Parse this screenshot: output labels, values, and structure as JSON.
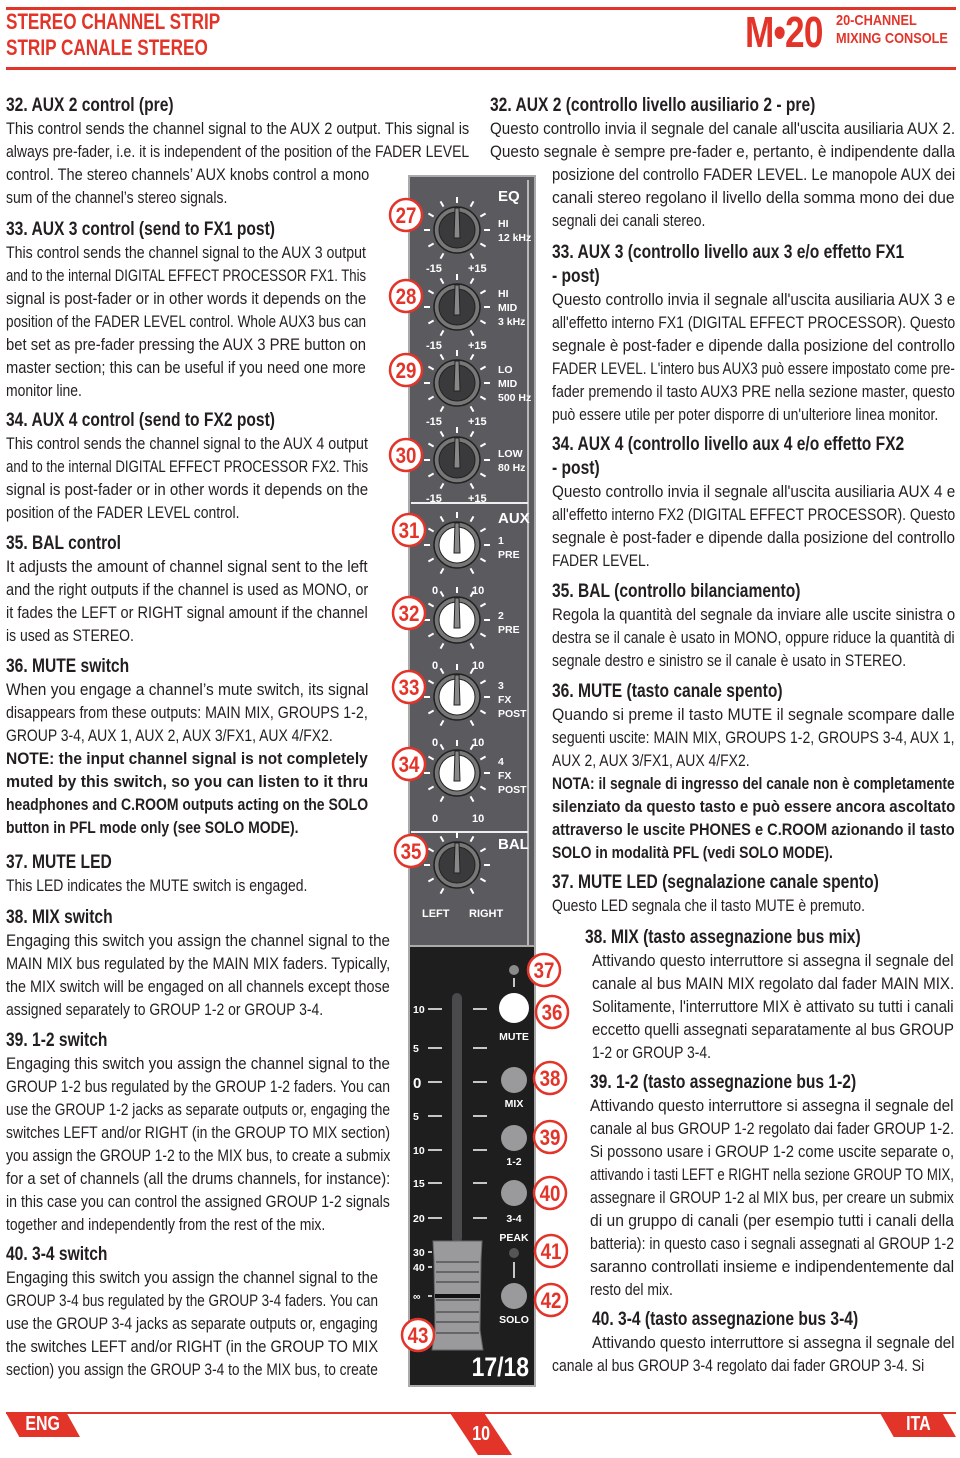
{
  "header": {
    "title_en": "STEREO CHANNEL STRIP",
    "title_it": "STRIP CANALE STEREO",
    "logo": "M•20",
    "logo_sub1": "20-CHANNEL",
    "logo_sub2": "MIXING CONSOLE"
  },
  "colors": {
    "accent": "#e3342a",
    "panel": "#5b5b5f",
    "panel_dark": "#1e1e1f"
  },
  "left": {
    "sections": [
      {
        "heading": [
          "32. AUX 2 control (pre)"
        ],
        "paragraphs": [
          {
            "bold": false,
            "lines": [
              "This control sends the channel signal to the AUX 2 output. This signal is",
              "always pre-fader, i.e. it is independent of the position of the FADER LEVEL",
              "control. The stereo channels’ AUX knobs control a mono",
              "sum of the channel’s stereo signals."
            ]
          }
        ]
      },
      {
        "heading": [
          "33. AUX 3 control (send to FX1 post)"
        ],
        "paragraphs": [
          {
            "bold": false,
            "lines": [
              "This control sends the channel signal to the AUX 3 output",
              "and to the internal DIGITAL EFFECT PROCESSOR FX1. This",
              "signal is post-fader or in other words it depends on the",
              "position of the FADER LEVEL control. Whole AUX3 bus can",
              "bet set as pre-fader pressing the AUX 3 PRE button on",
              "master section; this can be useful if you need one more",
              "monitor line."
            ]
          }
        ]
      },
      {
        "heading": [
          "34. AUX 4 control (send to FX2 post)"
        ],
        "paragraphs": [
          {
            "bold": false,
            "lines": [
              "This control sends the channel signal to the AUX 4 output",
              "and to the internal DIGITAL EFFECT PROCESSOR FX2. This",
              "signal is post-fader or in other words it depends on the",
              "position of the FADER LEVEL control."
            ]
          }
        ]
      },
      {
        "heading": [
          "35. BAL control"
        ],
        "paragraphs": [
          {
            "bold": false,
            "lines": [
              "It adjusts the amount of channel signal sent to the left",
              "and the right outputs if the channel is used as MONO, or",
              "it fades the LEFT or RIGHT signal amount if the channel",
              "is used as STEREO."
            ]
          }
        ]
      },
      {
        "heading": [
          "36. MUTE switch"
        ],
        "paragraphs": [
          {
            "bold": false,
            "lines": [
              "When you engage a channel’s mute switch, its signal",
              "disappears from these outputs: MAIN MIX, GROUPS 1-2,",
              "GROUP 3-4, AUX 1, AUX 2, AUX 3/FX1, AUX 4/FX2."
            ]
          },
          {
            "bold": true,
            "lines": [
              "NOTE: the input channel signal is not completely",
              "muted by this switch, so you can listen to it thru",
              "headphones and C.ROOM outputs acting on the SOLO",
              "button in PFL mode only (see SOLO MODE)."
            ]
          }
        ]
      },
      {
        "heading": [
          "37. MUTE LED"
        ],
        "paragraphs": [
          {
            "bold": false,
            "lines": [
              "This LED indicates the MUTE switch is engaged."
            ]
          }
        ]
      },
      {
        "heading": [
          "38. MIX switch"
        ],
        "paragraphs": [
          {
            "bold": false,
            "lines": [
              "Engaging this switch you assign the channel signal to the",
              "MAIN MIX bus regulated by the MAIN MIX faders. Typically,",
              "the MIX switch will be engaged on all channels except those",
              "assigned separately to GROUP 1-2 or GROUP 3-4."
            ]
          }
        ]
      },
      {
        "heading": [
          "39. 1-2 switch"
        ],
        "paragraphs": [
          {
            "bold": false,
            "lines": [
              "Engaging this switch you assign the channel signal to the",
              "GROUP 1-2 bus regulated by the GROUP 1-2 faders. You can",
              "use the GROUP 1-2 jacks as separate outputs or, engaging the",
              "switches LEFT and/or RIGHT (in the GROUP TO MIX section)",
              "you assign the GROUP 1-2 to the MIX bus, to create a submix",
              "for a set of channels (all the drums channels, for instance):",
              "in this case you can control the assigned GROUP 1-2 signals",
              "together and independently from the rest of the mix."
            ]
          }
        ]
      },
      {
        "heading": [
          "40. 3-4 switch"
        ],
        "paragraphs": [
          {
            "bold": false,
            "lines": [
              "Engaging this switch you assign the channel signal to the",
              "GROUP 3-4 bus regulated by the GROUP 3-4 faders. You can",
              "use the GROUP 3-4 jacks as separate outputs or, engaging",
              "the switches LEFT and/or RIGHT (in the GROUP TO MIX",
              "section) you assign the GROUP 3-4 to the MIX bus, to create"
            ]
          }
        ]
      }
    ]
  },
  "right": {
    "sections": [
      {
        "heading": [
          "32. AUX 2 (controllo livello ausiliario 2 - pre)"
        ],
        "paragraphs": [
          {
            "bold": false,
            "lines": [
              "Questo controllo invia il segnale del canale all'uscita ausiliaria AUX 2.",
              "Questo segnale è sempre pre-fader e, pertanto, è indipendente dalla",
              "posizione del controllo FADER LEVEL. Le manopole AUX dei",
              "canali stereo regolano il livello della somma mono dei due",
              "segnali dei canali stereo."
            ]
          }
        ]
      },
      {
        "heading": [
          "33. AUX 3 (controllo livello aux 3 e/o effetto FX1",
          "- post)"
        ],
        "paragraphs": [
          {
            "bold": false,
            "lines": [
              "Questo controllo invia il segnale all'uscita ausiliaria AUX 3 e",
              "all'effetto interno FX1 (DIGITAL EFFECT PROCESSOR). Questo",
              "segnale è post-fader e dipende dalla posizione del controllo",
              "FADER LEVEL. L'intero bus AUX3 può essere impostato come pre-",
              "fader premendo il tasto AUX3 PRE nella sezione master, questo",
              "può essere utile per poter disporre di un'ulteriore linea monitor."
            ]
          }
        ]
      },
      {
        "heading": [
          "34. AUX 4 (controllo livello aux 4 e/o effetto FX2",
          "- post)"
        ],
        "paragraphs": [
          {
            "bold": false,
            "lines": [
              "Questo controllo invia il segnale all'uscita ausiliaria AUX 4 e",
              "all'effetto interno FX2 (DIGITAL EFFECT PROCESSOR). Questo",
              "segnale è post-fader e dipende dalla posizione del controllo",
              "FADER LEVEL."
            ]
          }
        ]
      },
      {
        "heading": [
          "35. BAL (controllo bilanciamento)"
        ],
        "paragraphs": [
          {
            "bold": false,
            "lines": [
              "Regola la quantità del segnale da inviare alle uscite sinistra o",
              "destra se il canale è usato in MONO, oppure riduce la quantità di",
              "segnale destro e sinistro se il canale è usato in STEREO."
            ]
          }
        ]
      },
      {
        "heading": [
          "36. MUTE (tasto canale spento)"
        ],
        "paragraphs": [
          {
            "bold": false,
            "lines": [
              "Quando si preme il tasto MUTE il segnale scompare dalle",
              "seguenti uscite: MAIN MIX, GROUPS 1-2, GROUPS 3-4, AUX 1,",
              "AUX 2, AUX 3/FX1, AUX 4/FX2."
            ]
          },
          {
            "bold": true,
            "lines": [
              "NOTA: il segnale di ingresso del canale non è completamente",
              "silenziato da questo tasto e può essere ancora ascoltato",
              "attraverso le uscite PHONES e C.ROOM azionando il tasto",
              "SOLO in modalità PFL (vedi SOLO MODE)."
            ]
          }
        ]
      },
      {
        "heading": [
          "37. MUTE LED (segnalazione canale spento)"
        ],
        "paragraphs": [
          {
            "bold": false,
            "lines": [
              "Questo LED segnala che il tasto MUTE è premuto."
            ]
          }
        ]
      },
      {
        "heading": [
          "38. MIX (tasto assegnazione bus mix)"
        ],
        "paragraphs": [
          {
            "bold": false,
            "lines": [
              "Attivando questo interruttore si assegna il segnale del",
              "canale al bus MAIN MIX regolato dal fader MAIN MIX.",
              "Solitamente, l'interruttore MIX è attivato su tutti i canali",
              "eccetto quelli assegnati separatamente al bus GROUP",
              "1-2 or GROUP 3-4."
            ]
          }
        ]
      },
      {
        "heading": [
          "39. 1-2 (tasto assegnazione bus 1-2)"
        ],
        "paragraphs": [
          {
            "bold": false,
            "lines": [
              "Attivando questo interruttore si assegna il segnale del",
              "canale al bus GROUP 1-2 regolato dai fader GROUP 1-2.",
              "Si possono usare i GROUP 1-2 come uscite separate o,",
              "attivando i tasti LEFT e RIGHT nella sezione GROUP TO MIX,",
              "assegnare il GROUP 1-2 al MIX bus, per creare un submix",
              "di un gruppo di canali (per esempio tutti i canali della",
              "batteria): in questo caso i segnali assegnati al GROUP 1-2",
              "saranno controllati insieme e indipendentemente dal",
              "resto del mix."
            ]
          }
        ]
      },
      {
        "heading": [
          "40. 3-4 (tasto assegnazione bus 3-4)"
        ],
        "paragraphs": [
          {
            "bold": false,
            "lines": [
              "Attivando questo interruttore si assegna il segnale del",
              "canale al bus GROUP 3-4 regolato dai fader GROUP 3-4. Si"
            ]
          }
        ]
      }
    ]
  },
  "strip": {
    "eq_title": "EQ",
    "aux_title": "AUX",
    "bal_title": "BAL",
    "eq_knobs": [
      {
        "callout": "27",
        "label": [
          "HI",
          "12 kHz"
        ],
        "min": "-15",
        "max": "+15"
      },
      {
        "callout": "28",
        "label": [
          "HI",
          "MID",
          "3 kHz"
        ],
        "min": "-15",
        "max": "+15"
      },
      {
        "callout": "29",
        "label": [
          "LO",
          "MID",
          "500 Hz"
        ],
        "min": "-15",
        "max": "+15"
      },
      {
        "callout": "30",
        "label": [
          "LOW",
          "80 Hz"
        ],
        "min": "-15",
        "max": "+15"
      }
    ],
    "aux_knobs": [
      {
        "callout": "31",
        "label": [
          "1",
          "PRE"
        ],
        "min": "0",
        "max": "10"
      },
      {
        "callout": "32",
        "label": [
          "2",
          "PRE"
        ],
        "min": "0",
        "max": "10"
      },
      {
        "callout": "33",
        "label": [
          "3",
          "FX",
          "POST"
        ],
        "min": "0",
        "max": "10"
      },
      {
        "callout": "34",
        "label": [
          "4",
          "FX",
          "POST"
        ],
        "min": "0",
        "max": "10"
      }
    ],
    "bal_knob": {
      "callout": "35",
      "min": "LEFT",
      "max": "RIGHT"
    },
    "buttons": [
      {
        "callout": "37",
        "type": "led",
        "label": ""
      },
      {
        "callout": "36",
        "type": "mute",
        "label": "MUTE"
      },
      {
        "callout": "38",
        "type": "button",
        "label": "MIX"
      },
      {
        "callout": "39",
        "type": "button",
        "label": "1-2"
      },
      {
        "callout": "40",
        "type": "button",
        "label": "3-4"
      },
      {
        "callout": "41",
        "type": "peak-led",
        "label": "PEAK"
      },
      {
        "callout": "42",
        "type": "button",
        "label": "SOLO"
      }
    ],
    "fader_scale": [
      "10",
      "5",
      "0",
      "5",
      "10",
      "15",
      "20",
      "30",
      "40",
      "∞"
    ],
    "fader_callout": "43",
    "channel_label": "17/18"
  },
  "footer": {
    "left_tab": "ENG",
    "page_number": "10",
    "right_tab": "ITA"
  }
}
